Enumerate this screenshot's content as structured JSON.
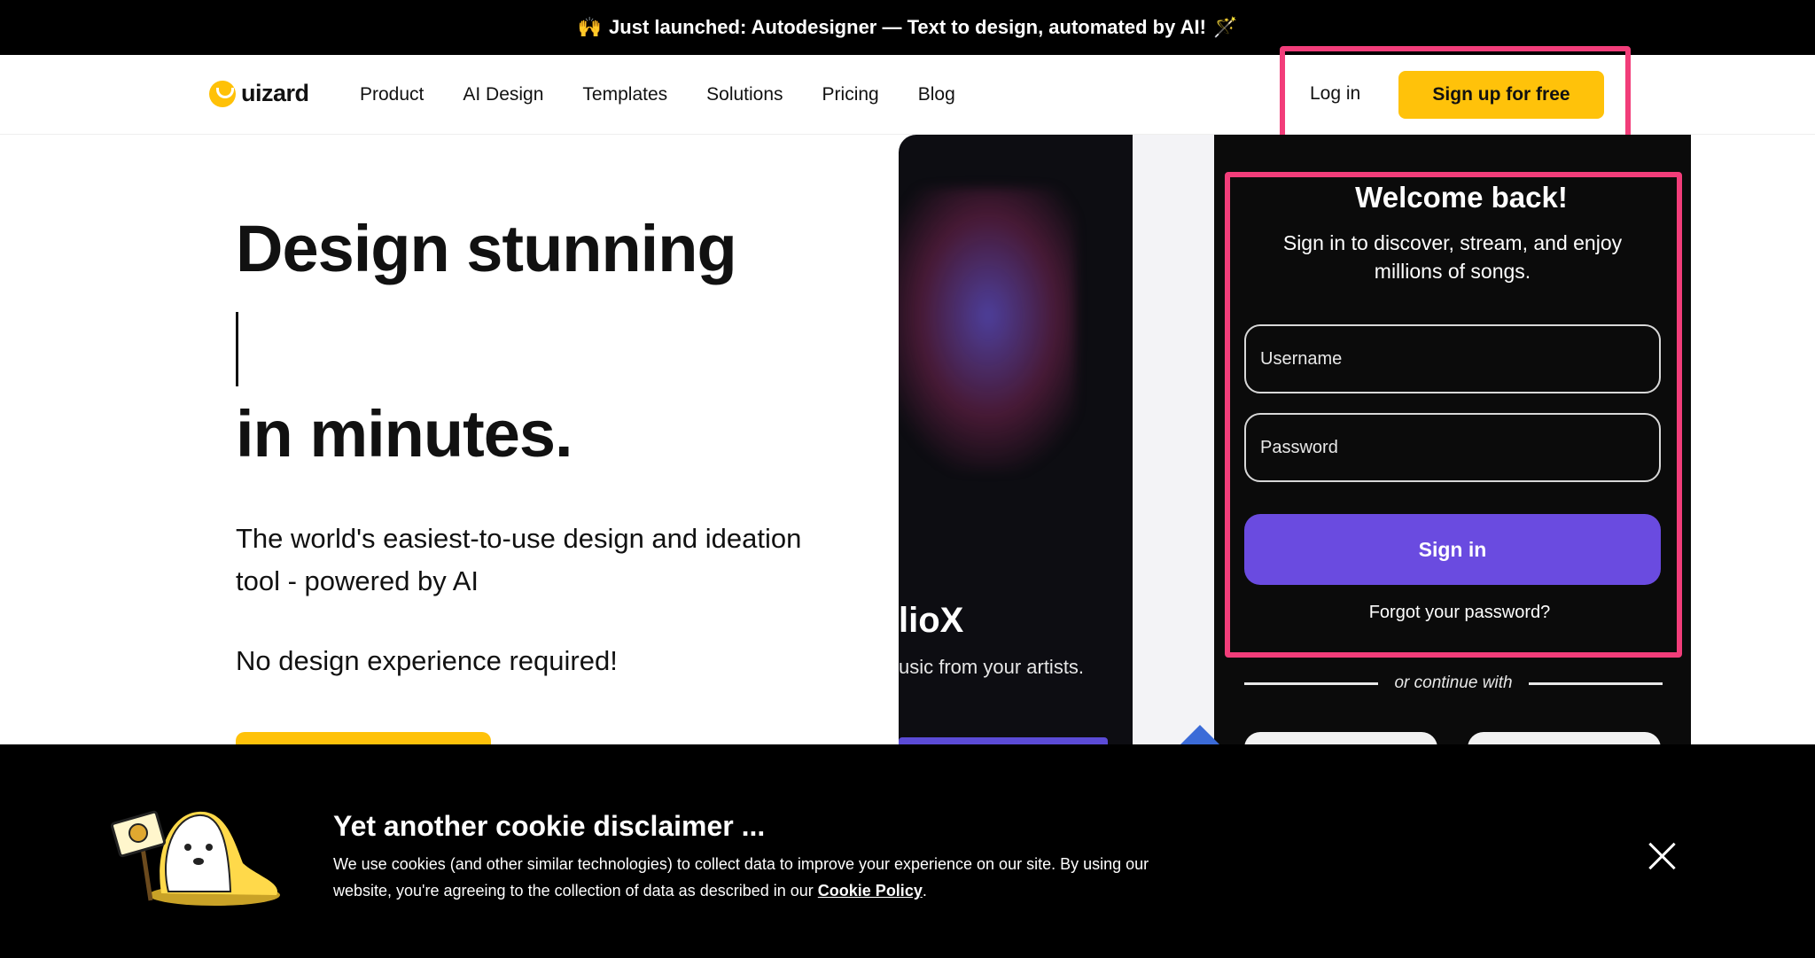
{
  "announcement": {
    "emoji_left": "🙌",
    "text": "Just launched: Autodesigner — Text to design, automated by AI!",
    "emoji_right": "🪄"
  },
  "nav": {
    "logo_text": "uizard",
    "links": [
      "Product",
      "AI Design",
      "Templates",
      "Solutions",
      "Pricing",
      "Blog"
    ],
    "login_label": "Log in",
    "signup_label": "Sign up for free"
  },
  "hero": {
    "title_line1": "Design stunning",
    "title_line2": "in minutes.",
    "subtitle": "The world's easiest-to-use design and ideation tool - powered by AI",
    "subtitle2": "No design experience required!"
  },
  "mockup": {
    "app_title_partial": "lioX",
    "app_desc_partial": "usic from your artists.",
    "login_card": {
      "title": "Welcome back!",
      "subtitle": "Sign in to discover, stream, and enjoy millions of songs.",
      "username_placeholder": "Username",
      "password_placeholder": "Password",
      "signin_label": "Sign in",
      "forgot_label": "Forgot your password?",
      "or_continue": "or continue with"
    }
  },
  "cookie_banner": {
    "title": "Yet another cookie disclaimer ...",
    "text": "We use cookies (and other similar technologies) to collect data to improve your experience on our site. By using our website, you're agreeing to the collection of data as described in our",
    "link_label": "Cookie Policy",
    "text_end": "."
  },
  "colors": {
    "brand_yellow": "#ffc20a",
    "highlight_pink": "#f23d7a",
    "signin_purple": "#6a4be0"
  }
}
